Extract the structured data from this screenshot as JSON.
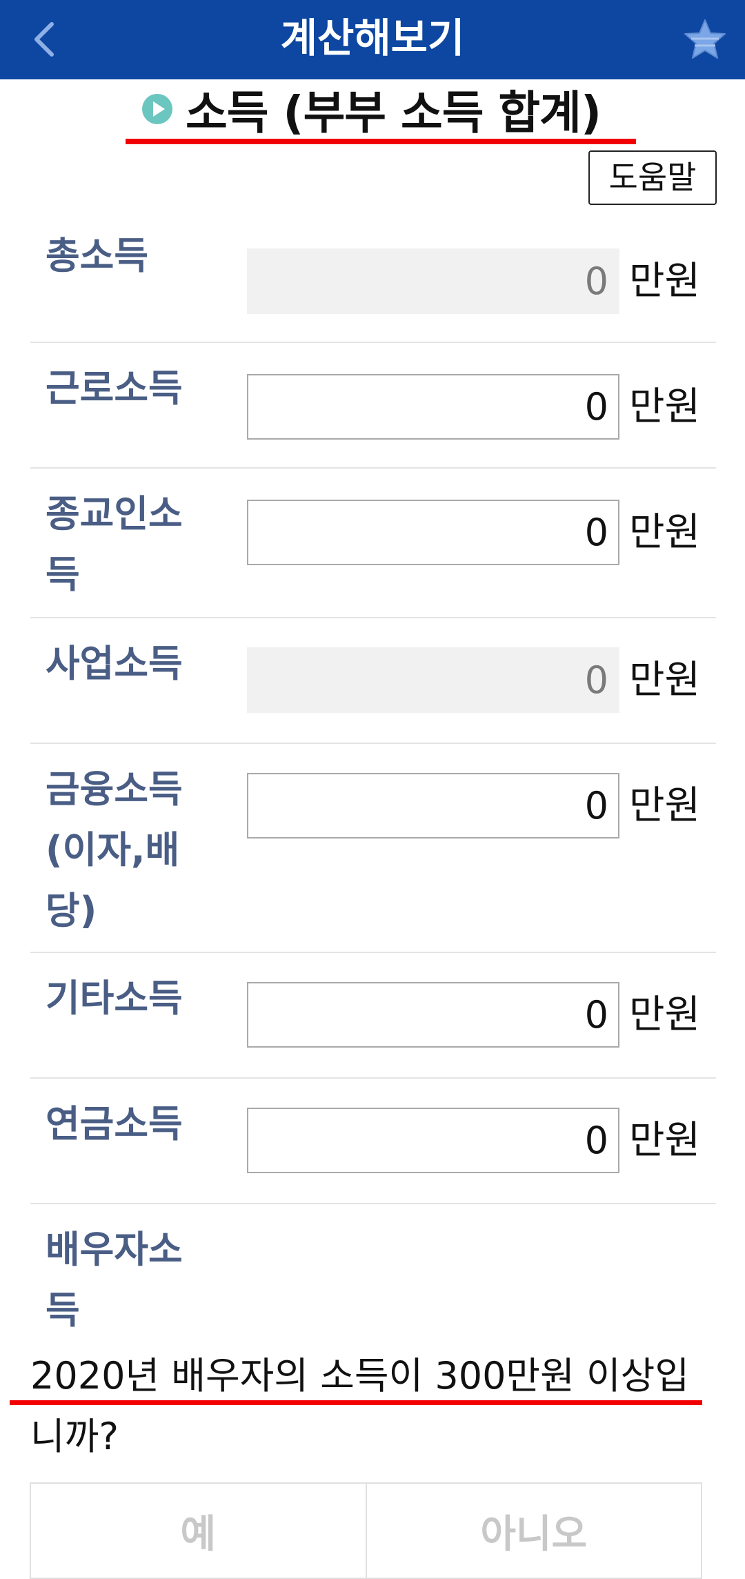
{
  "header": {
    "title": "계산해보기",
    "back_icon": "chevron-left-icon",
    "favorite_icon": "star-icon",
    "bar_color": "#0d47a1"
  },
  "section": {
    "title": "소득 (부부 소득 합계)",
    "icon": "play-circle-icon",
    "accent_color": "#6cc6c0",
    "help_label": "도움말"
  },
  "rows": [
    {
      "label": "총소득",
      "value": "0",
      "unit": "만원",
      "editable": false
    },
    {
      "label": "근로소득",
      "value": "0",
      "unit": "만원",
      "editable": true
    },
    {
      "label": "종교인소득",
      "value": "0",
      "unit": "만원",
      "editable": true
    },
    {
      "label": "사업소득",
      "value": "0",
      "unit": "만원",
      "editable": false
    },
    {
      "label": "금융소득(이자,배당)",
      "value": "0",
      "unit": "만원",
      "editable": true
    },
    {
      "label": "기타소득",
      "value": "0",
      "unit": "만원",
      "editable": true
    },
    {
      "label": "연금소득",
      "value": "0",
      "unit": "만원",
      "editable": true
    }
  ],
  "spouse": {
    "label": "배우자소득",
    "question": "2020년 배우자의 소득이 300만원 이상입니까?",
    "yes_label": "예",
    "no_label": "아니오"
  }
}
